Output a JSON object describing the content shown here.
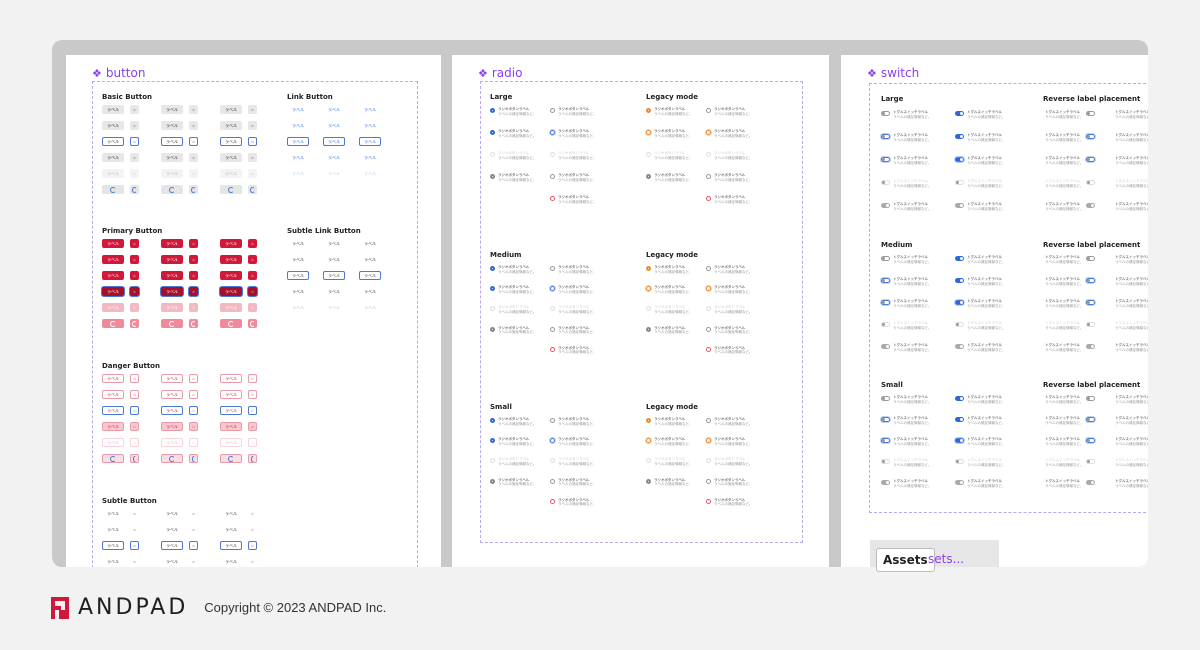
{
  "frames": {
    "button": {
      "title": "button"
    },
    "radio": {
      "title": "radio"
    },
    "switch": {
      "title": "switch"
    }
  },
  "button_sections": {
    "basic": "Basic Button",
    "link": "Link Button",
    "primary": "Primary Button",
    "subtle_link": "Subtle Link Button",
    "danger": "Danger Button",
    "subtle": "Subtle Button"
  },
  "button_label": "ラベル",
  "radio_sections": {
    "large": "Large",
    "legacy_large": "Legacy mode",
    "medium": "Medium",
    "legacy_medium": "Legacy mode",
    "small": "Small",
    "legacy_small": "Legacy mode"
  },
  "radio_label": "ラジオボタンラベル",
  "radio_sublabel": "ラベルの補足情報など。",
  "switch_sections": {
    "large": "Large",
    "reverse_large": "Reverse label placement",
    "medium": "Medium",
    "reverse_medium": "Reverse label placement",
    "small": "Small",
    "reverse_small": "Reverse label placement"
  },
  "switch_label": "トグルスイッチラベル",
  "switch_sublabel": "ラベルの補足情報など。",
  "assets": {
    "button": "Assets",
    "ghost": "sets..."
  },
  "footer": {
    "brand": "ANDPAD",
    "copyright": "Copyright © 2023 ANDPAD Inc."
  },
  "colors": {
    "accent": "#8a3ff2",
    "primary": "#d0193a",
    "link": "#2e69d9",
    "legacy": "#f08a2b"
  }
}
